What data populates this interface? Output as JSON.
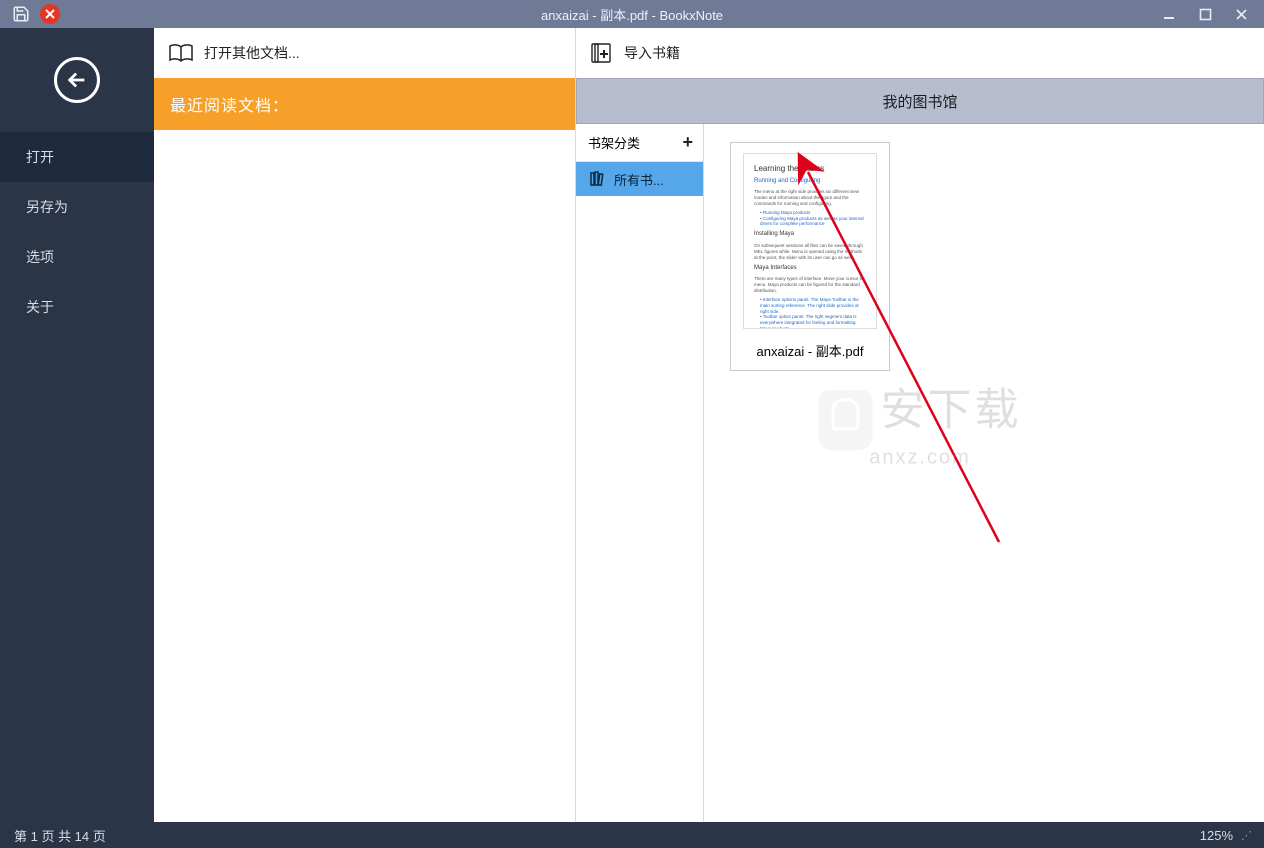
{
  "titlebar": {
    "title": "anxaizai - 副本.pdf - BookxNote"
  },
  "sidebar": {
    "items": [
      {
        "label": "打开",
        "active": true
      },
      {
        "label": "另存为",
        "active": false
      },
      {
        "label": "选项",
        "active": false
      },
      {
        "label": "关于",
        "active": false
      }
    ]
  },
  "recent": {
    "open_other": "打开其他文档...",
    "section_title": "最近阅读文档："
  },
  "library": {
    "import_label": "导入书籍",
    "title": "我的图书馆",
    "shelf_category_label": "书架分类",
    "all_books_label": "所有书...",
    "book_filename": "anxaizai - 副本.pdf",
    "thumb": {
      "heading": "Learning the Basics",
      "subheading": "Running and Configuring"
    }
  },
  "watermark": {
    "cn": "安下载",
    "en": "anxz.com"
  },
  "statusbar": {
    "page_info": "第 1 页 共 14 页",
    "zoom": "125%"
  }
}
